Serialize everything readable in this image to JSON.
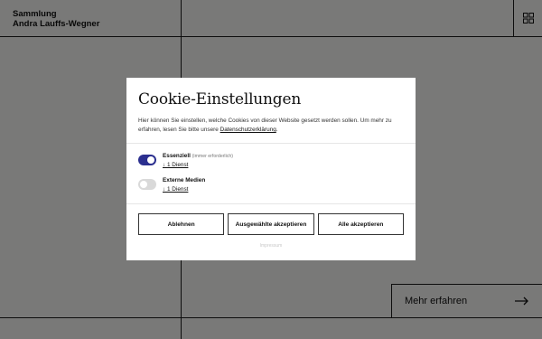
{
  "site": {
    "brand_line1": "Sammlung",
    "brand_line2": "Andra Lauffs-Wegner",
    "more_button": "Mehr erfahren",
    "menu_icon": "grid-icon",
    "arrow_icon": "arrow-right-icon"
  },
  "dialog": {
    "title": "Cookie-Einstellungen",
    "description_prefix": "Hier können Sie einstellen, welche Cookies von dieser Website gesetzt werden sollen. Um mehr zu erfahren, lesen Sie bitte unsere ",
    "privacy_link": "Datenschutzerklärung",
    "description_suffix": ".",
    "categories": [
      {
        "name": "Essenziell",
        "note": "(immer erforderlich)",
        "services": "↓ 1 Dienst",
        "enabled": true
      },
      {
        "name": "Externe Medien",
        "note": "",
        "services": "↓ 1 Dienst",
        "enabled": false
      }
    ],
    "buttons": {
      "decline": "Ablehnen",
      "accept_selected": "Ausgewählte akzeptieren",
      "accept_all": "Alle akzeptieren"
    },
    "footer_link": "Impressum"
  },
  "colors": {
    "toggle_on": "#2b2f8f",
    "toggle_off": "#d9d9d9",
    "overlay": "#000000"
  }
}
